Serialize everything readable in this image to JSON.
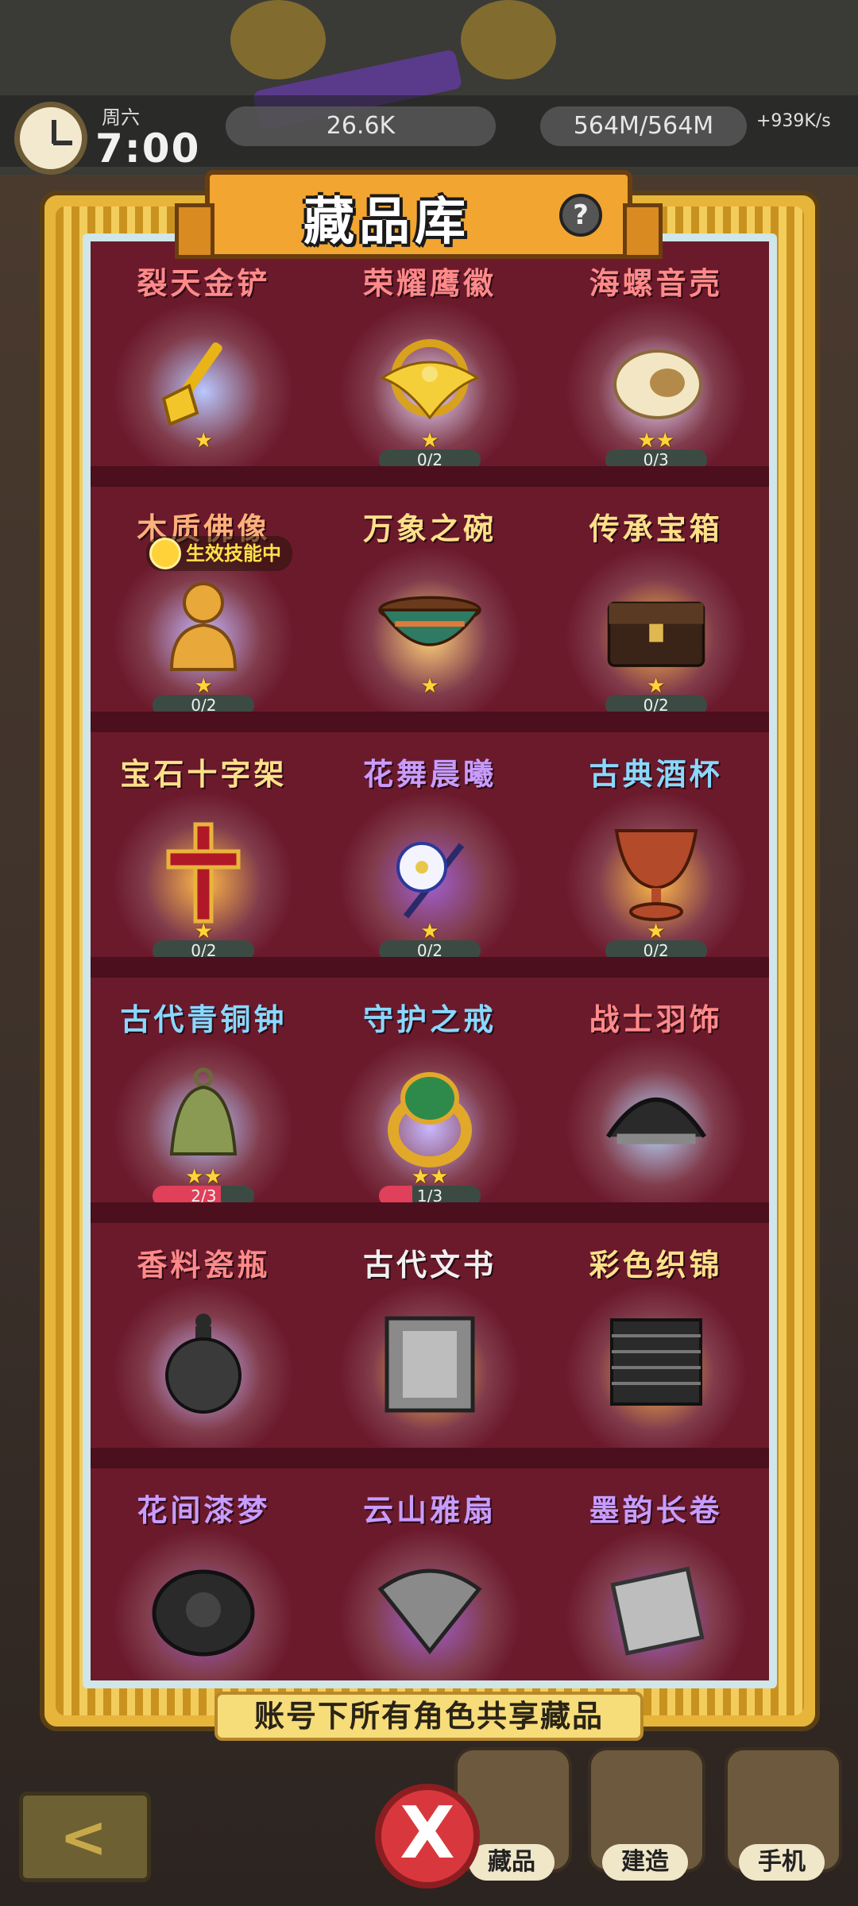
{
  "hud": {
    "day": "周六",
    "time": "7:00",
    "currency": "26.6K",
    "capacity": "564M/564M",
    "rate": "+939K/s"
  },
  "modal": {
    "title": "藏品库",
    "help_icon": "question-mark-icon",
    "shared_note": "账号下所有角色共享藏品",
    "close_label": "X"
  },
  "nav": {
    "collection": "藏品",
    "build": "建造",
    "phone": "手机",
    "back": "<"
  },
  "items": [
    {
      "name": "裂天金铲",
      "name_color": "#ff8a8a",
      "glow": "#b8c8ff",
      "icon": "golden-shovel-icon",
      "stars": "★",
      "progress": ""
    },
    {
      "name": "荣耀鹰徽",
      "name_color": "#ff8a8a",
      "glow": "#e8d8ff",
      "icon": "eagle-emblem-icon",
      "stars": "★",
      "progress": "0/2",
      "fill": 0
    },
    {
      "name": "海螺音壳",
      "name_color": "#ff8a8a",
      "glow": "#e8d8ff",
      "icon": "conch-shell-icon",
      "stars": "★★",
      "progress": "0/3",
      "fill": 0
    },
    {
      "name": "木质佛像",
      "name_color": "#ffb07a",
      "glow": "#c8b8ff",
      "icon": "buddha-statue-icon",
      "stars": "★",
      "progress": "0/2",
      "fill": 0,
      "badge": "生效技能中"
    },
    {
      "name": "万象之碗",
      "name_color": "#ffe08a",
      "glow": "#ffd27a",
      "icon": "bowl-icon",
      "stars": "★",
      "progress": ""
    },
    {
      "name": "传承宝箱",
      "name_color": "#ffe08a",
      "glow": "#ffb84a",
      "icon": "treasure-chest-icon",
      "stars": "★",
      "progress": "0/2",
      "fill": 0
    },
    {
      "name": "宝石十字架",
      "name_color": "#ffe08a",
      "glow": "#ffb84a",
      "icon": "jeweled-cross-icon",
      "stars": "★",
      "progress": "0/2",
      "fill": 0
    },
    {
      "name": "花舞晨曦",
      "name_color": "#c89cff",
      "glow": "#a060d0",
      "icon": "flower-hairpin-icon",
      "stars": "★",
      "progress": "0/2",
      "fill": 0
    },
    {
      "name": "古典酒杯",
      "name_color": "#8ad8ff",
      "glow": "#ffb84a",
      "icon": "goblet-icon",
      "stars": "★",
      "progress": "0/2",
      "fill": 0
    },
    {
      "name": "古代青铜钟",
      "name_color": "#8ad8ff",
      "glow": "#b8c8ff",
      "icon": "bronze-bell-icon",
      "stars": "★★",
      "progress": "2/3",
      "fill": 0.67
    },
    {
      "name": "守护之戒",
      "name_color": "#8ad8ff",
      "glow": "#c8b8ff",
      "icon": "jade-ring-icon",
      "stars": "★★",
      "progress": "1/3",
      "fill": 0.33
    },
    {
      "name": "战士羽饰",
      "name_color": "#ff8a8a",
      "glow": "#b8d8ff",
      "icon": "feather-headdress-icon",
      "stars": "",
      "progress": ""
    },
    {
      "name": "香料瓷瓶",
      "name_color": "#ff8a8a",
      "glow": "#c8b8ff",
      "icon": "spice-vase-icon",
      "stars": "",
      "progress": ""
    },
    {
      "name": "古代文书",
      "name_color": "#f0f0f0",
      "glow": "#ffb84a",
      "icon": "ancient-scroll-icon",
      "stars": "",
      "progress": ""
    },
    {
      "name": "彩色织锦",
      "name_color": "#ffe08a",
      "glow": "#ffb84a",
      "icon": "woven-tapestry-icon",
      "stars": "",
      "progress": ""
    },
    {
      "name": "花间漆梦",
      "name_color": "#c89cff",
      "glow": "#a060d0",
      "icon": "lacquer-box-icon",
      "stars": "",
      "progress": ""
    },
    {
      "name": "云山雅扇",
      "name_color": "#c89cff",
      "glow": "#a060d0",
      "icon": "folding-fan-icon",
      "stars": "",
      "progress": ""
    },
    {
      "name": "墨韵长卷",
      "name_color": "#c89cff",
      "glow": "#a060d0",
      "icon": "ink-scroll-icon",
      "stars": "",
      "progress": ""
    }
  ]
}
